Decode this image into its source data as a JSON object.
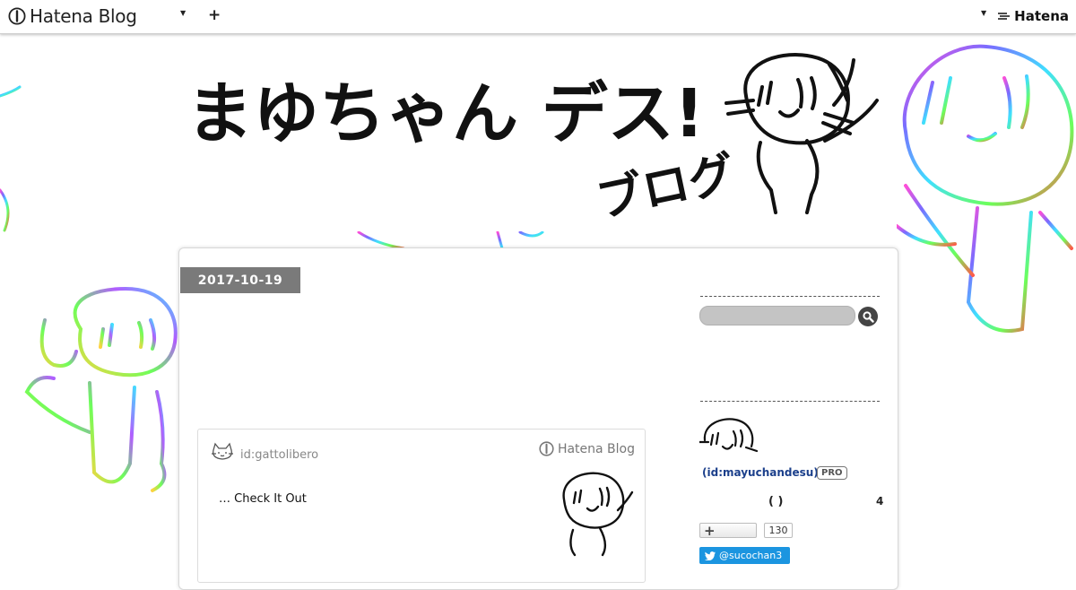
{
  "topbar": {
    "brand_name": "Hatena Blog",
    "add_label": "+",
    "hatena_label": "Hatena"
  },
  "banner": {
    "title": "まゆちゃん デス!",
    "subtitle": "ブログ"
  },
  "entry": {
    "date": "2017-10-19"
  },
  "embed": {
    "user_id": "id:gattolibero",
    "brand": "Hatena Blog",
    "link_text": "… Check It Out"
  },
  "sidebar": {
    "profile_id": "(id:mayuchandesu)",
    "pro_badge": "PRO",
    "paren_text": "( )",
    "count": "4",
    "follow_icon": "+",
    "follow_count": "130",
    "twitter_handle": "@sucochan3"
  },
  "colors": {
    "date_badge": "#7a7a7a",
    "profile_link": "#1b3f8b",
    "twitter": "#1b95e0",
    "search_field": "#c4c4c4"
  },
  "icons": [
    "hatena-blog-logo-icon",
    "chevron-down-icon",
    "plus-icon",
    "hatena-logo-icon",
    "search-icon",
    "twitter-bird-icon",
    "cat-avatar-icon"
  ]
}
